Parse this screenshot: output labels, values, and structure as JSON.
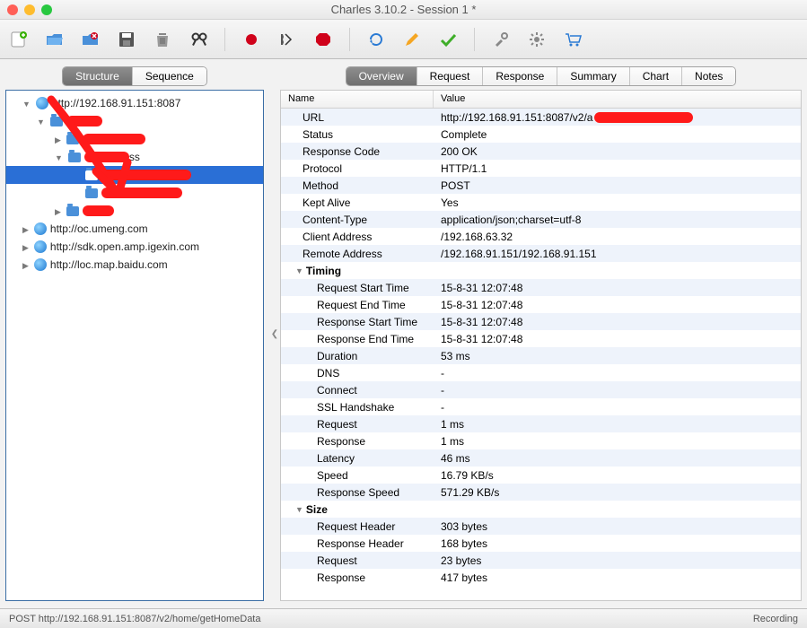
{
  "window": {
    "title": "Charles 3.10.2 - Session 1 *"
  },
  "left_tabs": {
    "structure": "Structure",
    "sequence": "Sequence"
  },
  "right_tabs": {
    "overview": "Overview",
    "request": "Request",
    "response": "Response",
    "summary": "Summary",
    "chart": "Chart",
    "notes": "Notes"
  },
  "tree": {
    "nodes": [
      {
        "label": "http://192.168.91.151:8087"
      },
      {
        "label": ""
      },
      {
        "label": ""
      },
      {
        "label": "ss"
      },
      {
        "label": ""
      },
      {
        "label": ""
      },
      {
        "label": ""
      },
      {
        "label": "http://oc.umeng.com"
      },
      {
        "label": "http://sdk.open.amp.igexin.com"
      },
      {
        "label": "http://loc.map.baidu.com"
      }
    ]
  },
  "detail": {
    "head_name": "Name",
    "head_value": "Value",
    "rows": [
      {
        "k": "URL",
        "v": "http://192.168.91.151:8087/v2/a"
      },
      {
        "k": "Status",
        "v": "Complete"
      },
      {
        "k": "Response Code",
        "v": "200 OK"
      },
      {
        "k": "Protocol",
        "v": "HTTP/1.1"
      },
      {
        "k": "Method",
        "v": "POST"
      },
      {
        "k": "Kept Alive",
        "v": "Yes"
      },
      {
        "k": "Content-Type",
        "v": "application/json;charset=utf-8"
      },
      {
        "k": "Client Address",
        "v": "/192.168.63.32"
      },
      {
        "k": "Remote Address",
        "v": "/192.168.91.151/192.168.91.151"
      }
    ],
    "timing_label": "Timing",
    "timing": [
      {
        "k": "Request Start Time",
        "v": "15-8-31 12:07:48"
      },
      {
        "k": "Request End Time",
        "v": "15-8-31 12:07:48"
      },
      {
        "k": "Response Start Time",
        "v": "15-8-31 12:07:48"
      },
      {
        "k": "Response End Time",
        "v": "15-8-31 12:07:48"
      },
      {
        "k": "Duration",
        "v": "53 ms"
      },
      {
        "k": "DNS",
        "v": "-"
      },
      {
        "k": "Connect",
        "v": "-"
      },
      {
        "k": "SSL Handshake",
        "v": "-"
      },
      {
        "k": "Request",
        "v": "1 ms"
      },
      {
        "k": "Response",
        "v": "1 ms"
      },
      {
        "k": "Latency",
        "v": "46 ms"
      },
      {
        "k": "Speed",
        "v": "16.79 KB/s"
      },
      {
        "k": "Response Speed",
        "v": "571.29 KB/s"
      }
    ],
    "size_label": "Size",
    "size": [
      {
        "k": "Request Header",
        "v": "303 bytes"
      },
      {
        "k": "Response Header",
        "v": "168 bytes"
      },
      {
        "k": "Request",
        "v": "23 bytes"
      },
      {
        "k": "Response",
        "v": "417 bytes"
      }
    ]
  },
  "statusbar": {
    "left": "POST http://192.168.91.151:8087/v2/home/getHomeData",
    "right": "Recording"
  }
}
